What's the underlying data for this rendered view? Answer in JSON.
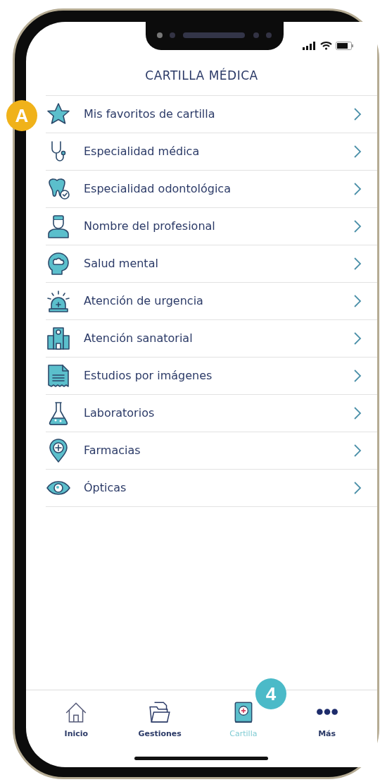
{
  "title": "CARTILLA MÉDICA",
  "items": [
    {
      "label": "Mis favoritos de cartilla"
    },
    {
      "label": "Especialidad médica"
    },
    {
      "label": "Especialidad odontológica"
    },
    {
      "label": "Nombre del profesional"
    },
    {
      "label": "Salud mental"
    },
    {
      "label": "Atención de urgencia"
    },
    {
      "label": "Atención sanatorial"
    },
    {
      "label": "Estudios por imágenes"
    },
    {
      "label": "Laboratorios"
    },
    {
      "label": "Farmacias"
    },
    {
      "label": "Ópticas"
    }
  ],
  "tabs": [
    {
      "label": "Inicio",
      "selected": false
    },
    {
      "label": "Gestiones",
      "selected": false
    },
    {
      "label": "Cartilla",
      "selected": true
    },
    {
      "label": "Más",
      "selected": false
    }
  ],
  "callouts": [
    {
      "label": "A",
      "color": "#f0b21a"
    },
    {
      "label": "4",
      "color": "#4bbac8"
    }
  ]
}
